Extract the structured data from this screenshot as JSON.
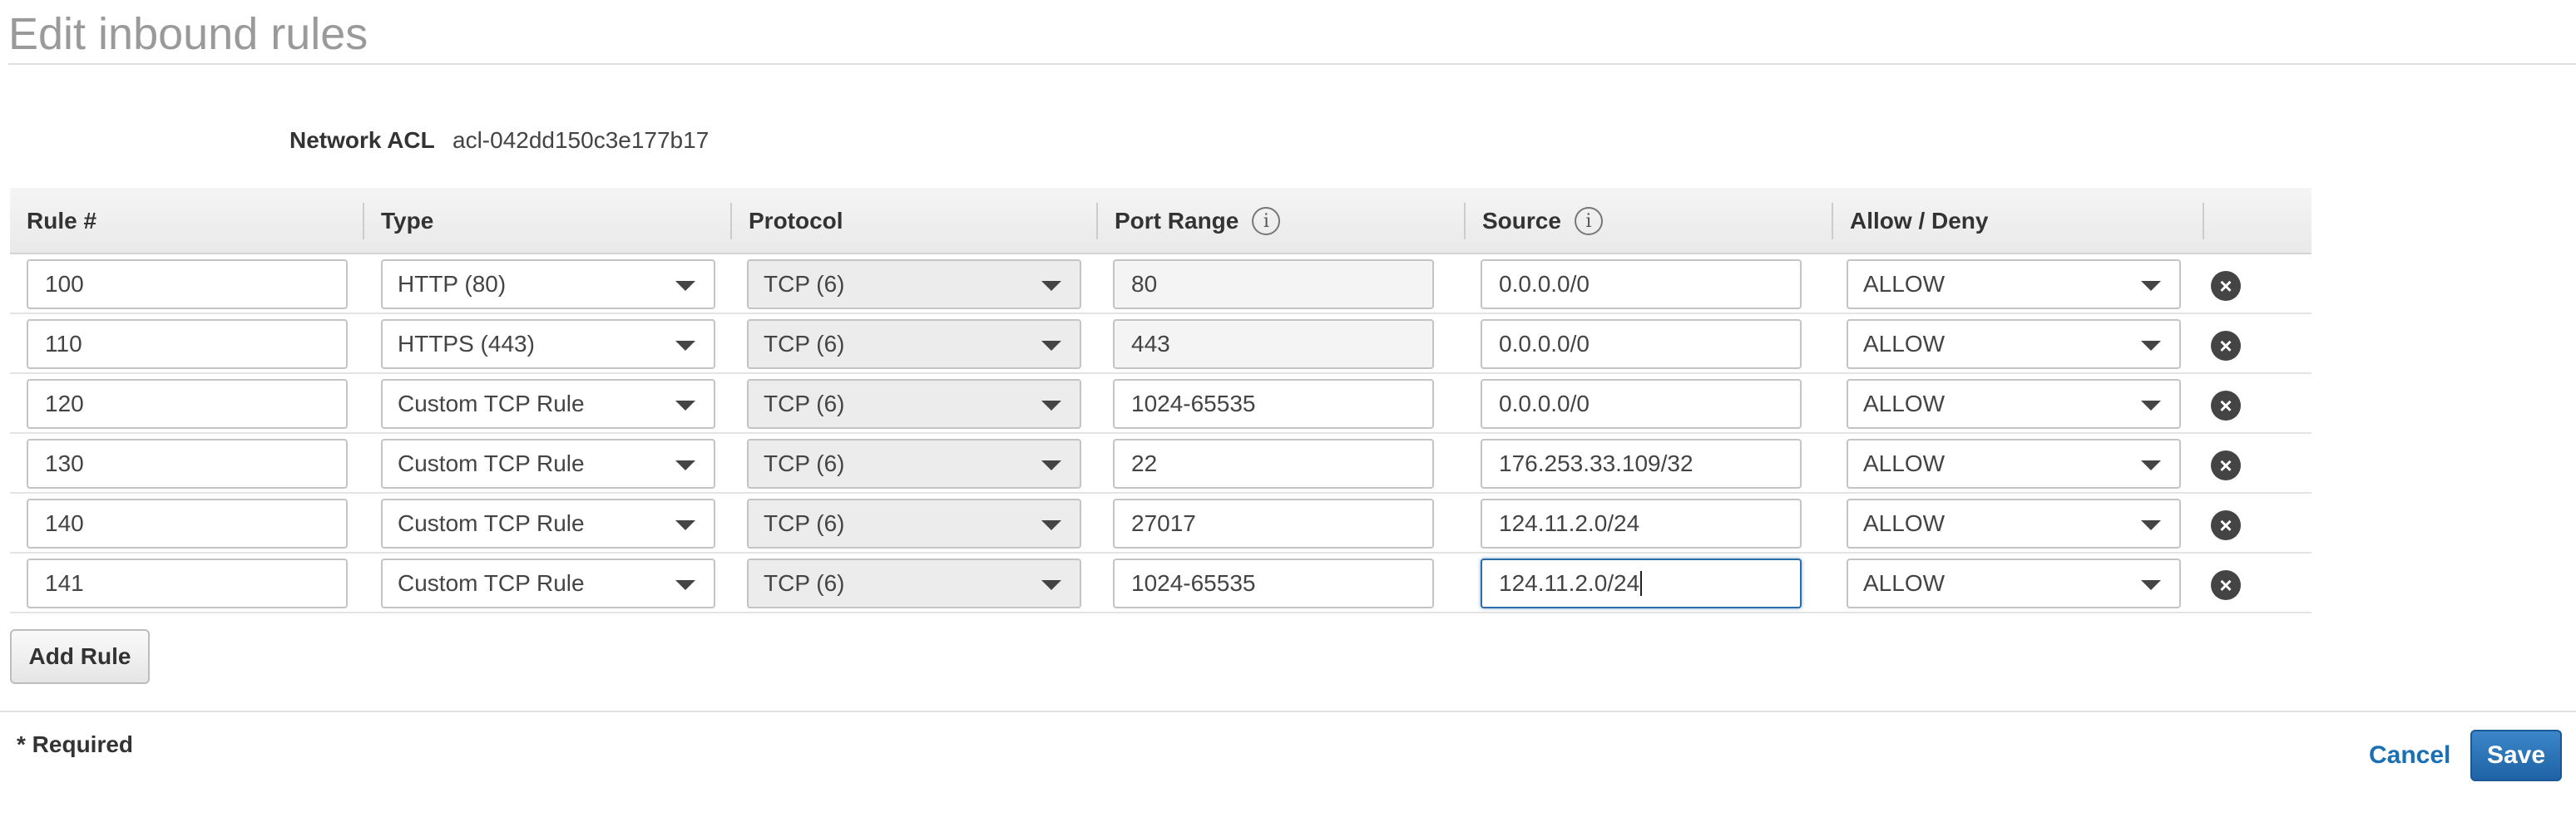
{
  "title": "Edit inbound rules",
  "acl": {
    "label": "Network ACL",
    "value": "acl-042dd150c3e177b17"
  },
  "headers": {
    "rule": "Rule #",
    "type": "Type",
    "protocol": "Protocol",
    "port_range": "Port Range",
    "source": "Source",
    "allow_deny": "Allow / Deny"
  },
  "info_glyph": "i",
  "remove_glyph": "×",
  "rows": [
    {
      "rule": "100",
      "type": "HTTP (80)",
      "protocol": "TCP (6)",
      "port": "80",
      "source": "0.0.0.0/0",
      "action": "ALLOW"
    },
    {
      "rule": "110",
      "type": "HTTPS (443)",
      "protocol": "TCP (6)",
      "port": "443",
      "source": "0.0.0.0/0",
      "action": "ALLOW"
    },
    {
      "rule": "120",
      "type": "Custom TCP Rule",
      "protocol": "TCP (6)",
      "port": "1024-65535",
      "source": "0.0.0.0/0",
      "action": "ALLOW"
    },
    {
      "rule": "130",
      "type": "Custom TCP Rule",
      "protocol": "TCP (6)",
      "port": "22",
      "source": "176.253.33.109/32",
      "action": "ALLOW"
    },
    {
      "rule": "140",
      "type": "Custom TCP Rule",
      "protocol": "TCP (6)",
      "port": "27017",
      "source": "124.11.2.0/24",
      "action": "ALLOW"
    },
    {
      "rule": "141",
      "type": "Custom TCP Rule",
      "protocol": "TCP (6)",
      "port": "1024-65535",
      "source": "124.11.2.0/24",
      "action": "ALLOW"
    }
  ],
  "buttons": {
    "add_rule": "Add Rule",
    "cancel": "Cancel",
    "save": "Save"
  },
  "required_note": "* Required",
  "colors": {
    "primary": "#1f63a6",
    "link": "#1a6fb5",
    "focus": "#2d6ea8"
  }
}
